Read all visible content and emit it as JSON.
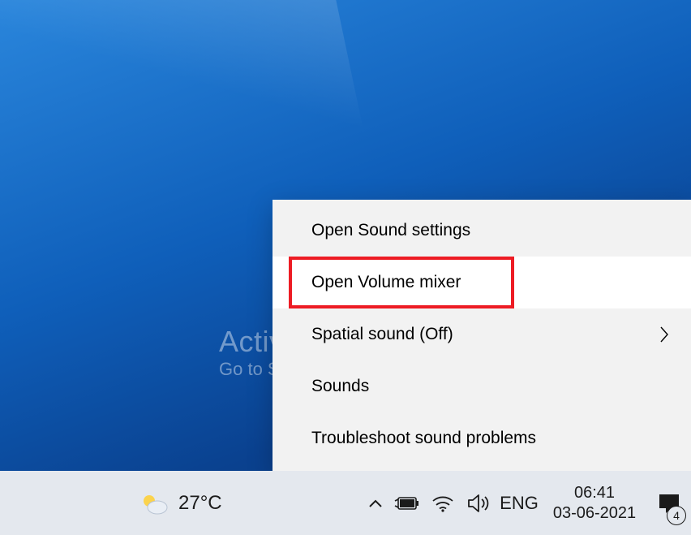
{
  "watermark": {
    "title": "Activate Windows",
    "subtitle": "Go to Settings to activate Windows."
  },
  "context_menu": {
    "items": [
      {
        "label": "Open Sound settings",
        "submenu": false,
        "hover": false
      },
      {
        "label": "Open Volume mixer",
        "submenu": false,
        "hover": true
      },
      {
        "label": "Spatial sound (Off)",
        "submenu": true,
        "hover": false
      },
      {
        "label": "Sounds",
        "submenu": false,
        "hover": false
      },
      {
        "label": "Troubleshoot sound problems",
        "submenu": false,
        "hover": false
      }
    ]
  },
  "taskbar": {
    "weather_temp": "27°C",
    "lang": "ENG",
    "time": "06:41",
    "date": "03-06-2021",
    "notification_count": "4"
  },
  "annotations": {
    "highlighted_menu_item_index": 1,
    "highlighted_tray_icon": "volume-icon"
  }
}
